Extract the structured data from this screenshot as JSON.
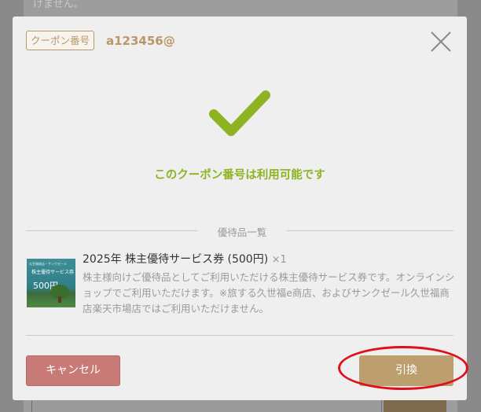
{
  "background": {
    "top_text": "けません。"
  },
  "modal": {
    "coupon_label": "クーポン番号",
    "coupon_code": "a123456@",
    "status_message": "このクーポン番号は利用可能です",
    "section_title": "優待品一覧",
    "item": {
      "name": "2025年 株主優待サービス券 (500円)",
      "quantity": "×1",
      "description": "株主様向けご優待品としてご利用いただける株主優待サービス券です。オンラインショップでご利用いただけます。※旅する久世福e商店、およびサンクゼール久世福商店楽天市場店ではご利用いただけません。",
      "thumbnail": {
        "caption": "久世福商店・サンクゼール",
        "title": "株主優待サービス券",
        "price": "500円"
      }
    },
    "cancel_label": "キャンセル",
    "exchange_label": "引換"
  },
  "colors": {
    "accent_gold": "#bd9e6e",
    "success_green": "#8db322",
    "cancel_red": "#c87a76",
    "highlight_red": "#e0101a"
  },
  "icons": {
    "close": "close-icon",
    "check": "checkmark-icon"
  }
}
